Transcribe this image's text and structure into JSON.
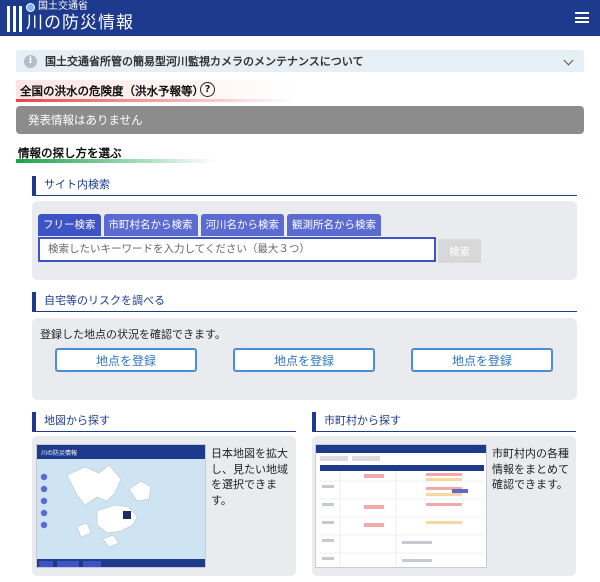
{
  "header": {
    "ministry": "国土交通省",
    "title": "川の防災情報"
  },
  "notice": {
    "text": "国土交通省所管の簡易型河川監視カメラのメンテナンスについて"
  },
  "flood": {
    "heading": "全国の洪水の危険度（洪水予報等）",
    "help_glyph": "?",
    "no_info": "発表情報はありません"
  },
  "method": {
    "heading": "情報の探し方を選ぶ"
  },
  "site_search": {
    "heading": "サイト内検索",
    "tabs": [
      "フリー検索",
      "市町村名から検索",
      "河川名から検索",
      "観測所名から検索"
    ],
    "placeholder": "検索したいキーワードを入力してください（最大３つ）",
    "button": "検索"
  },
  "risk": {
    "heading": "自宅等のリスクを調べる",
    "description": "登録した地点の状況を確認できます。",
    "buttons": [
      "地点を登録",
      "地点を登録",
      "地点を登録"
    ]
  },
  "map_card": {
    "heading": "地図から探す",
    "lines": [
      "日本地図を拡大",
      "し、見たい地域",
      "を選択できま",
      "す。"
    ],
    "thumb_title": "川の防災情報"
  },
  "muni_card": {
    "heading": "市町村から探す",
    "lines": [
      "市町村内の各種",
      "情報をまとめて",
      "確認できます。"
    ]
  },
  "colors": {
    "brand": "#1d3a8c",
    "tab": "#5b6bd0",
    "panel": "#e9ebee",
    "alert_red": "#e64646",
    "accent_green": "#1aa34a"
  }
}
